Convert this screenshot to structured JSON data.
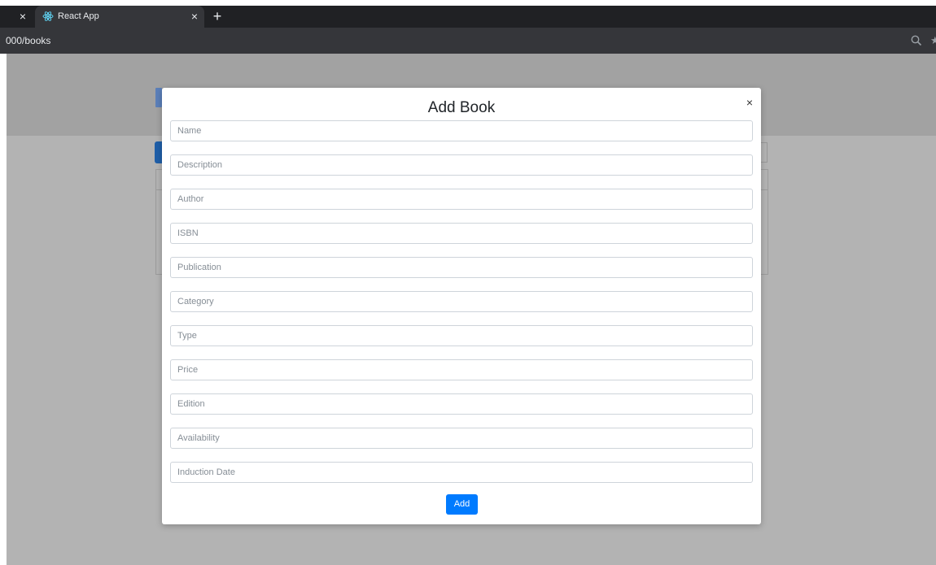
{
  "browser": {
    "tab_title": "React App",
    "url": "000/books",
    "close_glyph": "×",
    "new_tab_glyph": "+",
    "favicon": "react-icon",
    "zoom_icon": "magnifier-icon"
  },
  "modal": {
    "title": "Add Book",
    "close_glyph": "×",
    "fields": [
      {
        "placeholder": "Name"
      },
      {
        "placeholder": "Description"
      },
      {
        "placeholder": "Author"
      },
      {
        "placeholder": "ISBN"
      },
      {
        "placeholder": "Publication"
      },
      {
        "placeholder": "Category"
      },
      {
        "placeholder": "Type"
      },
      {
        "placeholder": "Price"
      },
      {
        "placeholder": "Edition"
      },
      {
        "placeholder": "Availability"
      },
      {
        "placeholder": "Induction Date"
      }
    ],
    "submit_label": "Add"
  },
  "colors": {
    "overlay": "#b3b3b3",
    "primary": "#007bff",
    "chrome_dark": "#202124",
    "chrome_tab": "#35363a"
  }
}
